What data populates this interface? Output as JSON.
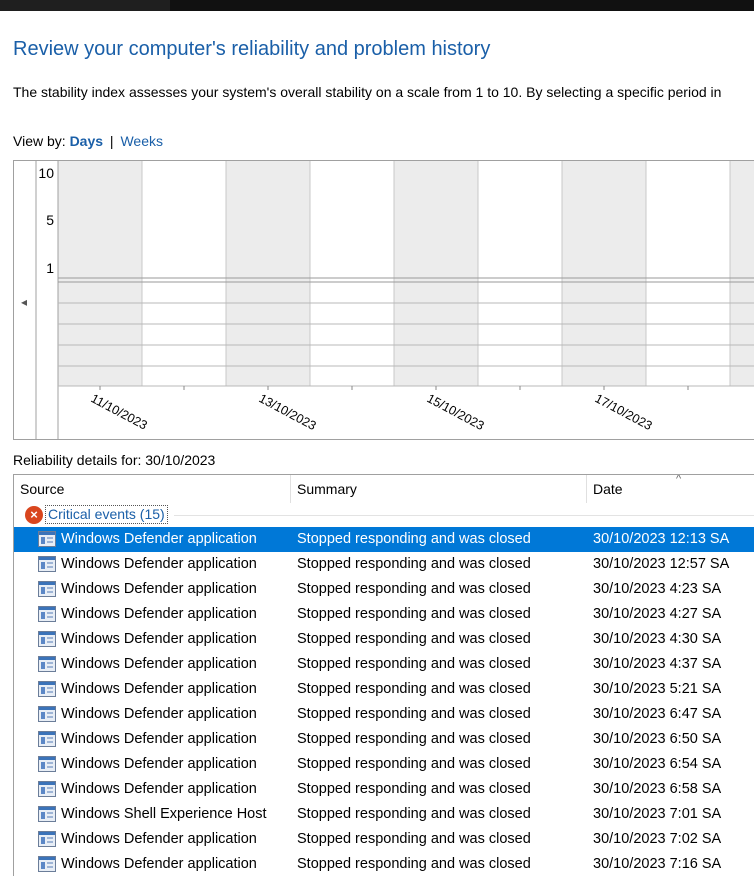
{
  "page": {
    "title": "Review your computer's reliability and problem history",
    "description": "The stability index assesses your system's overall stability on a scale from 1 to 10. By selecting a specific period in"
  },
  "view_by": {
    "label": "View by:",
    "days": "Days",
    "separator": "|",
    "weeks": "Weeks"
  },
  "chart": {
    "y_ticks": [
      "10",
      "5",
      "1"
    ],
    "x_labels": [
      "11/10/2023",
      "13/10/2023",
      "15/10/2023",
      "17/10/2023"
    ],
    "left_arrow": "◂"
  },
  "details": {
    "label": "Reliability details for: 30/10/2023"
  },
  "table": {
    "columns": [
      "Source",
      "Summary",
      "Date"
    ],
    "group": {
      "label": "Critical events (15)",
      "icon": "error-icon"
    },
    "rows": [
      {
        "source": "Windows Defender application",
        "summary": "Stopped responding and was closed",
        "date": "30/10/2023 12:13 SA",
        "selected": true
      },
      {
        "source": "Windows Defender application",
        "summary": "Stopped responding and was closed",
        "date": "30/10/2023 12:57 SA"
      },
      {
        "source": "Windows Defender application",
        "summary": "Stopped responding and was closed",
        "date": "30/10/2023 4:23 SA"
      },
      {
        "source": "Windows Defender application",
        "summary": "Stopped responding and was closed",
        "date": "30/10/2023 4:27 SA"
      },
      {
        "source": "Windows Defender application",
        "summary": "Stopped responding and was closed",
        "date": "30/10/2023 4:30 SA"
      },
      {
        "source": "Windows Defender application",
        "summary": "Stopped responding and was closed",
        "date": "30/10/2023 4:37 SA"
      },
      {
        "source": "Windows Defender application",
        "summary": "Stopped responding and was closed",
        "date": "30/10/2023 5:21 SA"
      },
      {
        "source": "Windows Defender application",
        "summary": "Stopped responding and was closed",
        "date": "30/10/2023 6:47 SA"
      },
      {
        "source": "Windows Defender application",
        "summary": "Stopped responding and was closed",
        "date": "30/10/2023 6:50 SA"
      },
      {
        "source": "Windows Defender application",
        "summary": "Stopped responding and was closed",
        "date": "30/10/2023 6:54 SA"
      },
      {
        "source": "Windows Defender application",
        "summary": "Stopped responding and was closed",
        "date": "30/10/2023 6:58 SA"
      },
      {
        "source": "Windows Shell Experience Host",
        "summary": "Stopped responding and was closed",
        "date": "30/10/2023 7:01 SA"
      },
      {
        "source": "Windows Defender application",
        "summary": "Stopped responding and was closed",
        "date": "30/10/2023 7:02 SA"
      },
      {
        "source": "Windows Defender application",
        "summary": "Stopped responding and was closed",
        "date": "30/10/2023 7:16 SA"
      }
    ]
  },
  "colors": {
    "link": "#1a5fa8",
    "selection": "#0078d7",
    "shaded_column": "#ececec",
    "error": "#d9461e"
  }
}
